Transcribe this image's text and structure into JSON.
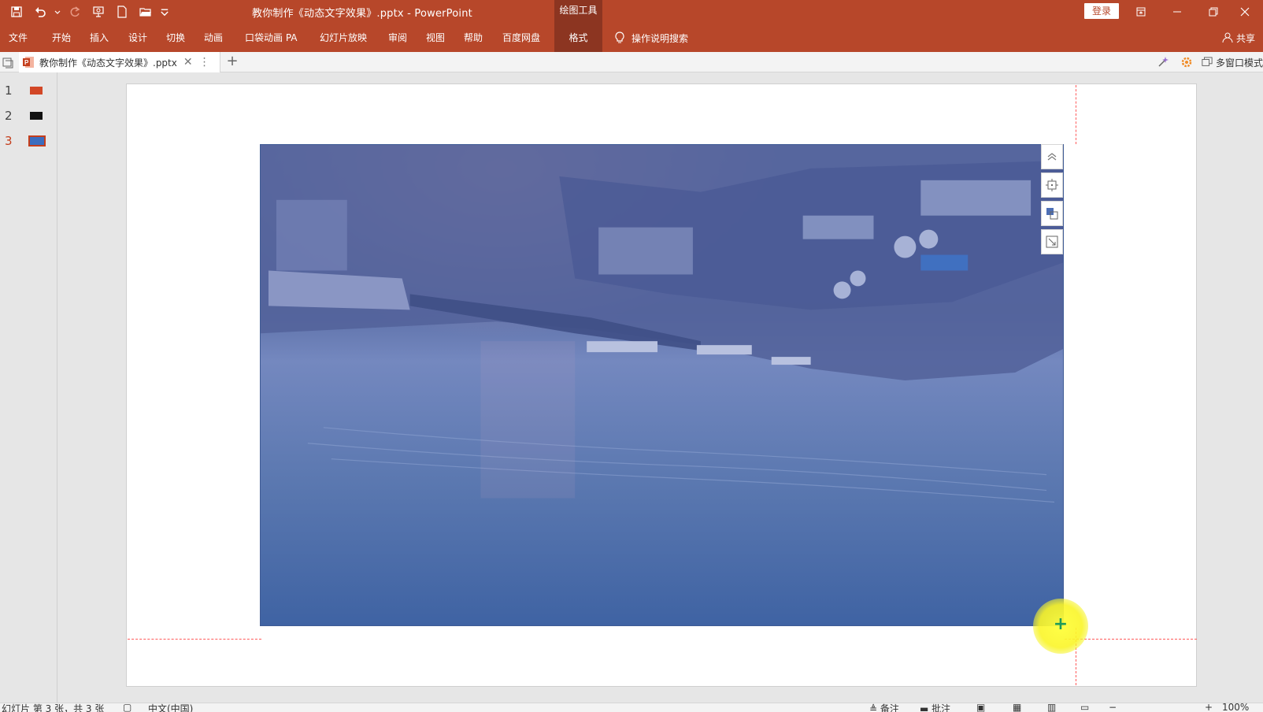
{
  "titlebar": {
    "title": "教你制作《动态文字效果》.pptx  -  PowerPoint",
    "context_tab": "绘图工具",
    "login": "登录"
  },
  "ribbon": {
    "tabs": [
      "文件",
      "开始",
      "插入",
      "设计",
      "切换",
      "动画",
      "口袋动画 PA",
      "幻灯片放映",
      "审阅",
      "视图",
      "帮助",
      "百度网盘",
      "格式"
    ],
    "search_label": "操作说明搜索",
    "share_label": "共享"
  },
  "doc_tab": {
    "filename": "教你制作《动态文字效果》.pptx",
    "multiwindow_label": "多窗口模式"
  },
  "thumbnails": [
    {
      "num": "1",
      "color": "#d24726"
    },
    {
      "num": "2",
      "color": "#111111"
    },
    {
      "num": "3",
      "color": "#3b6dbf",
      "active": true
    }
  ],
  "statusbar": {
    "slide_info": "幻灯片 第 3 张，共 3 张",
    "language": "中文(中国)",
    "notes": "备注",
    "comments": "批注",
    "zoom": "100%"
  },
  "colors": {
    "accent": "#b7472a",
    "accent_dark": "#8c3521",
    "guide": "#ff5a5a"
  }
}
